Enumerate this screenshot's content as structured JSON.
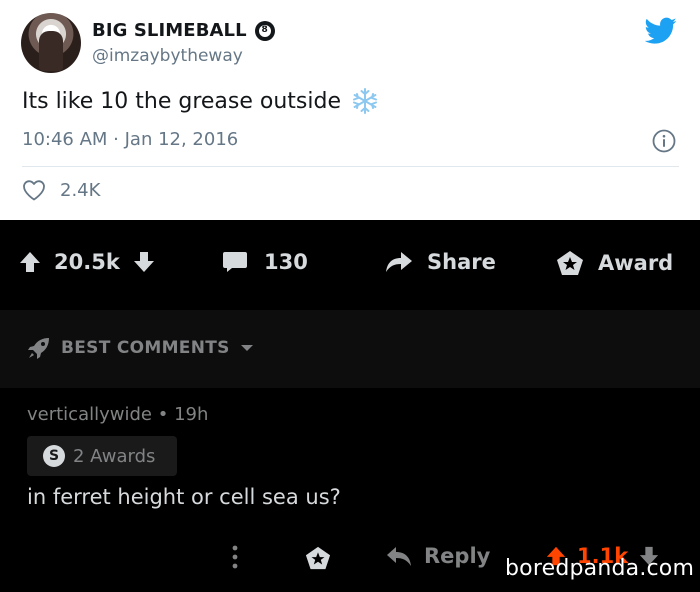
{
  "tweet": {
    "author_name": "BIG SLIMEBALL",
    "verified_badge_glyph": "8",
    "handle": "@imzaybytheway",
    "text": "Its like 10 the grease outside",
    "emoji_icon": "snowflake-icon",
    "meta": "10:46 AM · Jan 12, 2016",
    "likes": "2.4K",
    "colors": {
      "text": "#14171a",
      "secondary": "#657786",
      "bird": "#1da1f2",
      "emoji": "#8cc8f0"
    }
  },
  "post_actions": {
    "votes": "20.5k",
    "comments": "130",
    "share_label": "Share",
    "award_label": "Award"
  },
  "sort": {
    "label": "BEST COMMENTS"
  },
  "comment": {
    "username": "verticallywide",
    "time": "19h",
    "awards_label": "2 Awards",
    "award_glyph": "S",
    "body": "in ferret height or cell sea us?",
    "reply_label": "Reply",
    "votes": "1.1k",
    "colors": {
      "upvote": "#ff4500",
      "muted": "#818384",
      "text": "#d7dadc"
    }
  },
  "watermark": "boredpanda.com"
}
